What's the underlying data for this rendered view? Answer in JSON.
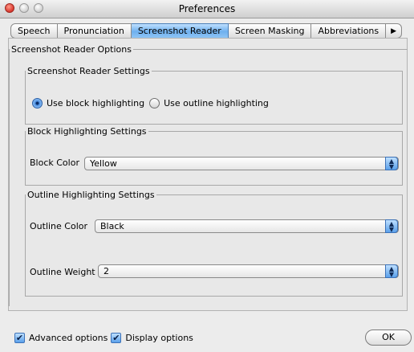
{
  "window": {
    "title": "Preferences"
  },
  "tabs": [
    {
      "label": "Speech"
    },
    {
      "label": "Pronunciation"
    },
    {
      "label": "Screenshot Reader"
    },
    {
      "label": "Screen Masking"
    },
    {
      "label": "Abbreviations"
    },
    {
      "label": "▶"
    }
  ],
  "options_group": {
    "legend": "Screenshot Reader Options"
  },
  "settings_group": {
    "legend": "Screenshot Reader Settings",
    "block_radio_label": "Use block highlighting",
    "outline_radio_label": "Use outline highlighting",
    "selected": "block"
  },
  "block_group": {
    "legend": "Block Highlighting Settings",
    "color_label": "Block Color",
    "color_value": "Yellow"
  },
  "outline_group": {
    "legend": "Outline Highlighting Settings",
    "color_label": "Outline Color",
    "color_value": "Black",
    "weight_label": "Outline Weight",
    "weight_value": "2"
  },
  "footer": {
    "advanced_label": "Advanced options",
    "display_label": "Display options",
    "ok_label": "OK"
  }
}
